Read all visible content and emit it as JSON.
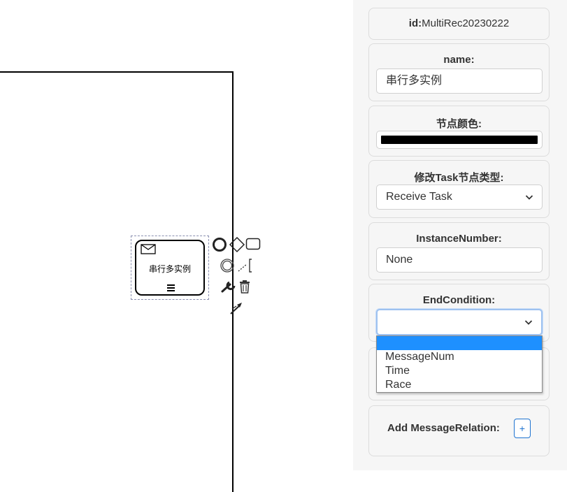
{
  "canvas": {
    "task": {
      "label": "串行多实例",
      "type_icon": "envelope-icon",
      "marker_icon": "sequential-multi-instance-icon"
    },
    "context_pad": [
      "start-event-icon",
      "exclusive-gateway-icon",
      "task-icon",
      "intermediate-event-icon",
      "text-annotation-icon",
      "wrench-icon",
      "trash-icon",
      "connect-arrow-icon"
    ]
  },
  "panel": {
    "id": {
      "label": "id:",
      "value": "MultiRec20230222"
    },
    "name": {
      "label": "name:",
      "value": "串行多实例"
    },
    "node_color": {
      "label": "节点颜色:",
      "value": "#000000"
    },
    "task_type": {
      "label": "修改Task节点类型:",
      "selected": "Receive Task"
    },
    "instance_number": {
      "label": "InstanceNumber:",
      "value": "None"
    },
    "end_condition": {
      "label": "EndCondition:",
      "selected": "",
      "options": [
        "",
        "MessageNum",
        "Time",
        "Race"
      ]
    },
    "message_relation": {
      "label": "Add MessageRelation:",
      "button": "+"
    }
  },
  "colors": {
    "accent": "#1e90ff",
    "button_border": "#1e73d0",
    "panel_bg": "#f6f6f6"
  }
}
